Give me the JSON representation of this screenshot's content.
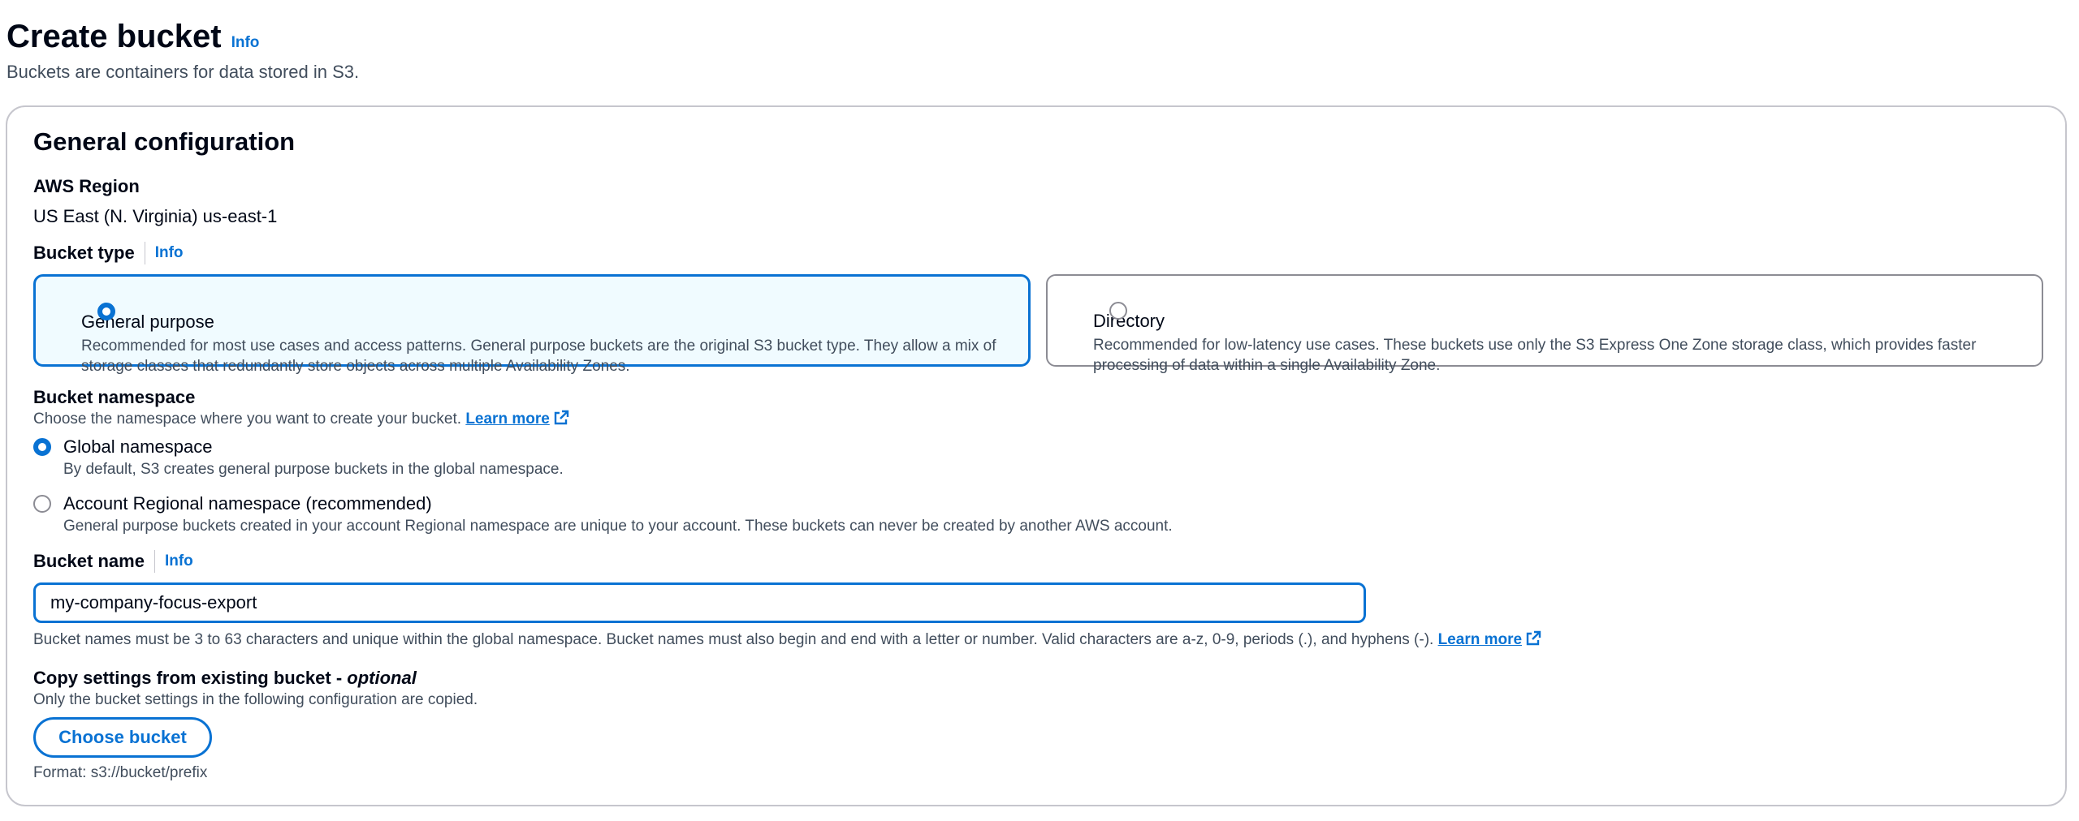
{
  "page": {
    "title": "Create bucket",
    "info_label": "Info",
    "description": "Buckets are containers for data stored in S3."
  },
  "general_config": {
    "title": "General configuration",
    "region": {
      "label": "AWS Region",
      "value": "US East (N. Virginia) us-east-1"
    },
    "bucket_type": {
      "label": "Bucket type",
      "info_label": "Info",
      "options": [
        {
          "title": "General purpose",
          "description": "Recommended for most use cases and access patterns. General purpose buckets are the original S3 bucket type. They allow a mix of storage classes that redundantly store objects across multiple Availability Zones.",
          "selected": true
        },
        {
          "title": "Directory",
          "description": "Recommended for low-latency use cases. These buckets use only the S3 Express One Zone storage class, which provides faster processing of data within a single Availability Zone.",
          "selected": false
        }
      ]
    },
    "namespace": {
      "label": "Bucket namespace",
      "description": "Choose the namespace where you want to create your bucket.",
      "learn_more": "Learn more",
      "options": [
        {
          "title": "Global namespace",
          "description": "By default, S3 creates general purpose buckets in the global namespace.",
          "selected": true
        },
        {
          "title": "Account Regional namespace (recommended)",
          "description": "General purpose buckets created in your account Regional namespace are unique to your account. These buckets can never be created by another AWS account.",
          "selected": false
        }
      ]
    },
    "bucket_name": {
      "label": "Bucket name",
      "info_label": "Info",
      "value": "my-company-focus-export",
      "hint": "Bucket names must be 3 to 63 characters and unique within the global namespace. Bucket names must also begin and end with a letter or number. Valid characters are a-z, 0-9, periods (.), and hyphens (-).",
      "learn_more": "Learn more"
    },
    "copy_settings": {
      "label": "Copy settings from existing bucket - ",
      "optional": "optional",
      "description": "Only the bucket settings in the following configuration are copied.",
      "button_label": "Choose bucket",
      "format": "Format: s3://bucket/prefix"
    }
  },
  "colors": {
    "accent": "#0972d3",
    "text": "#000716",
    "secondary_text": "#414d5c",
    "selected_tile_bg": "#f0fbff"
  }
}
